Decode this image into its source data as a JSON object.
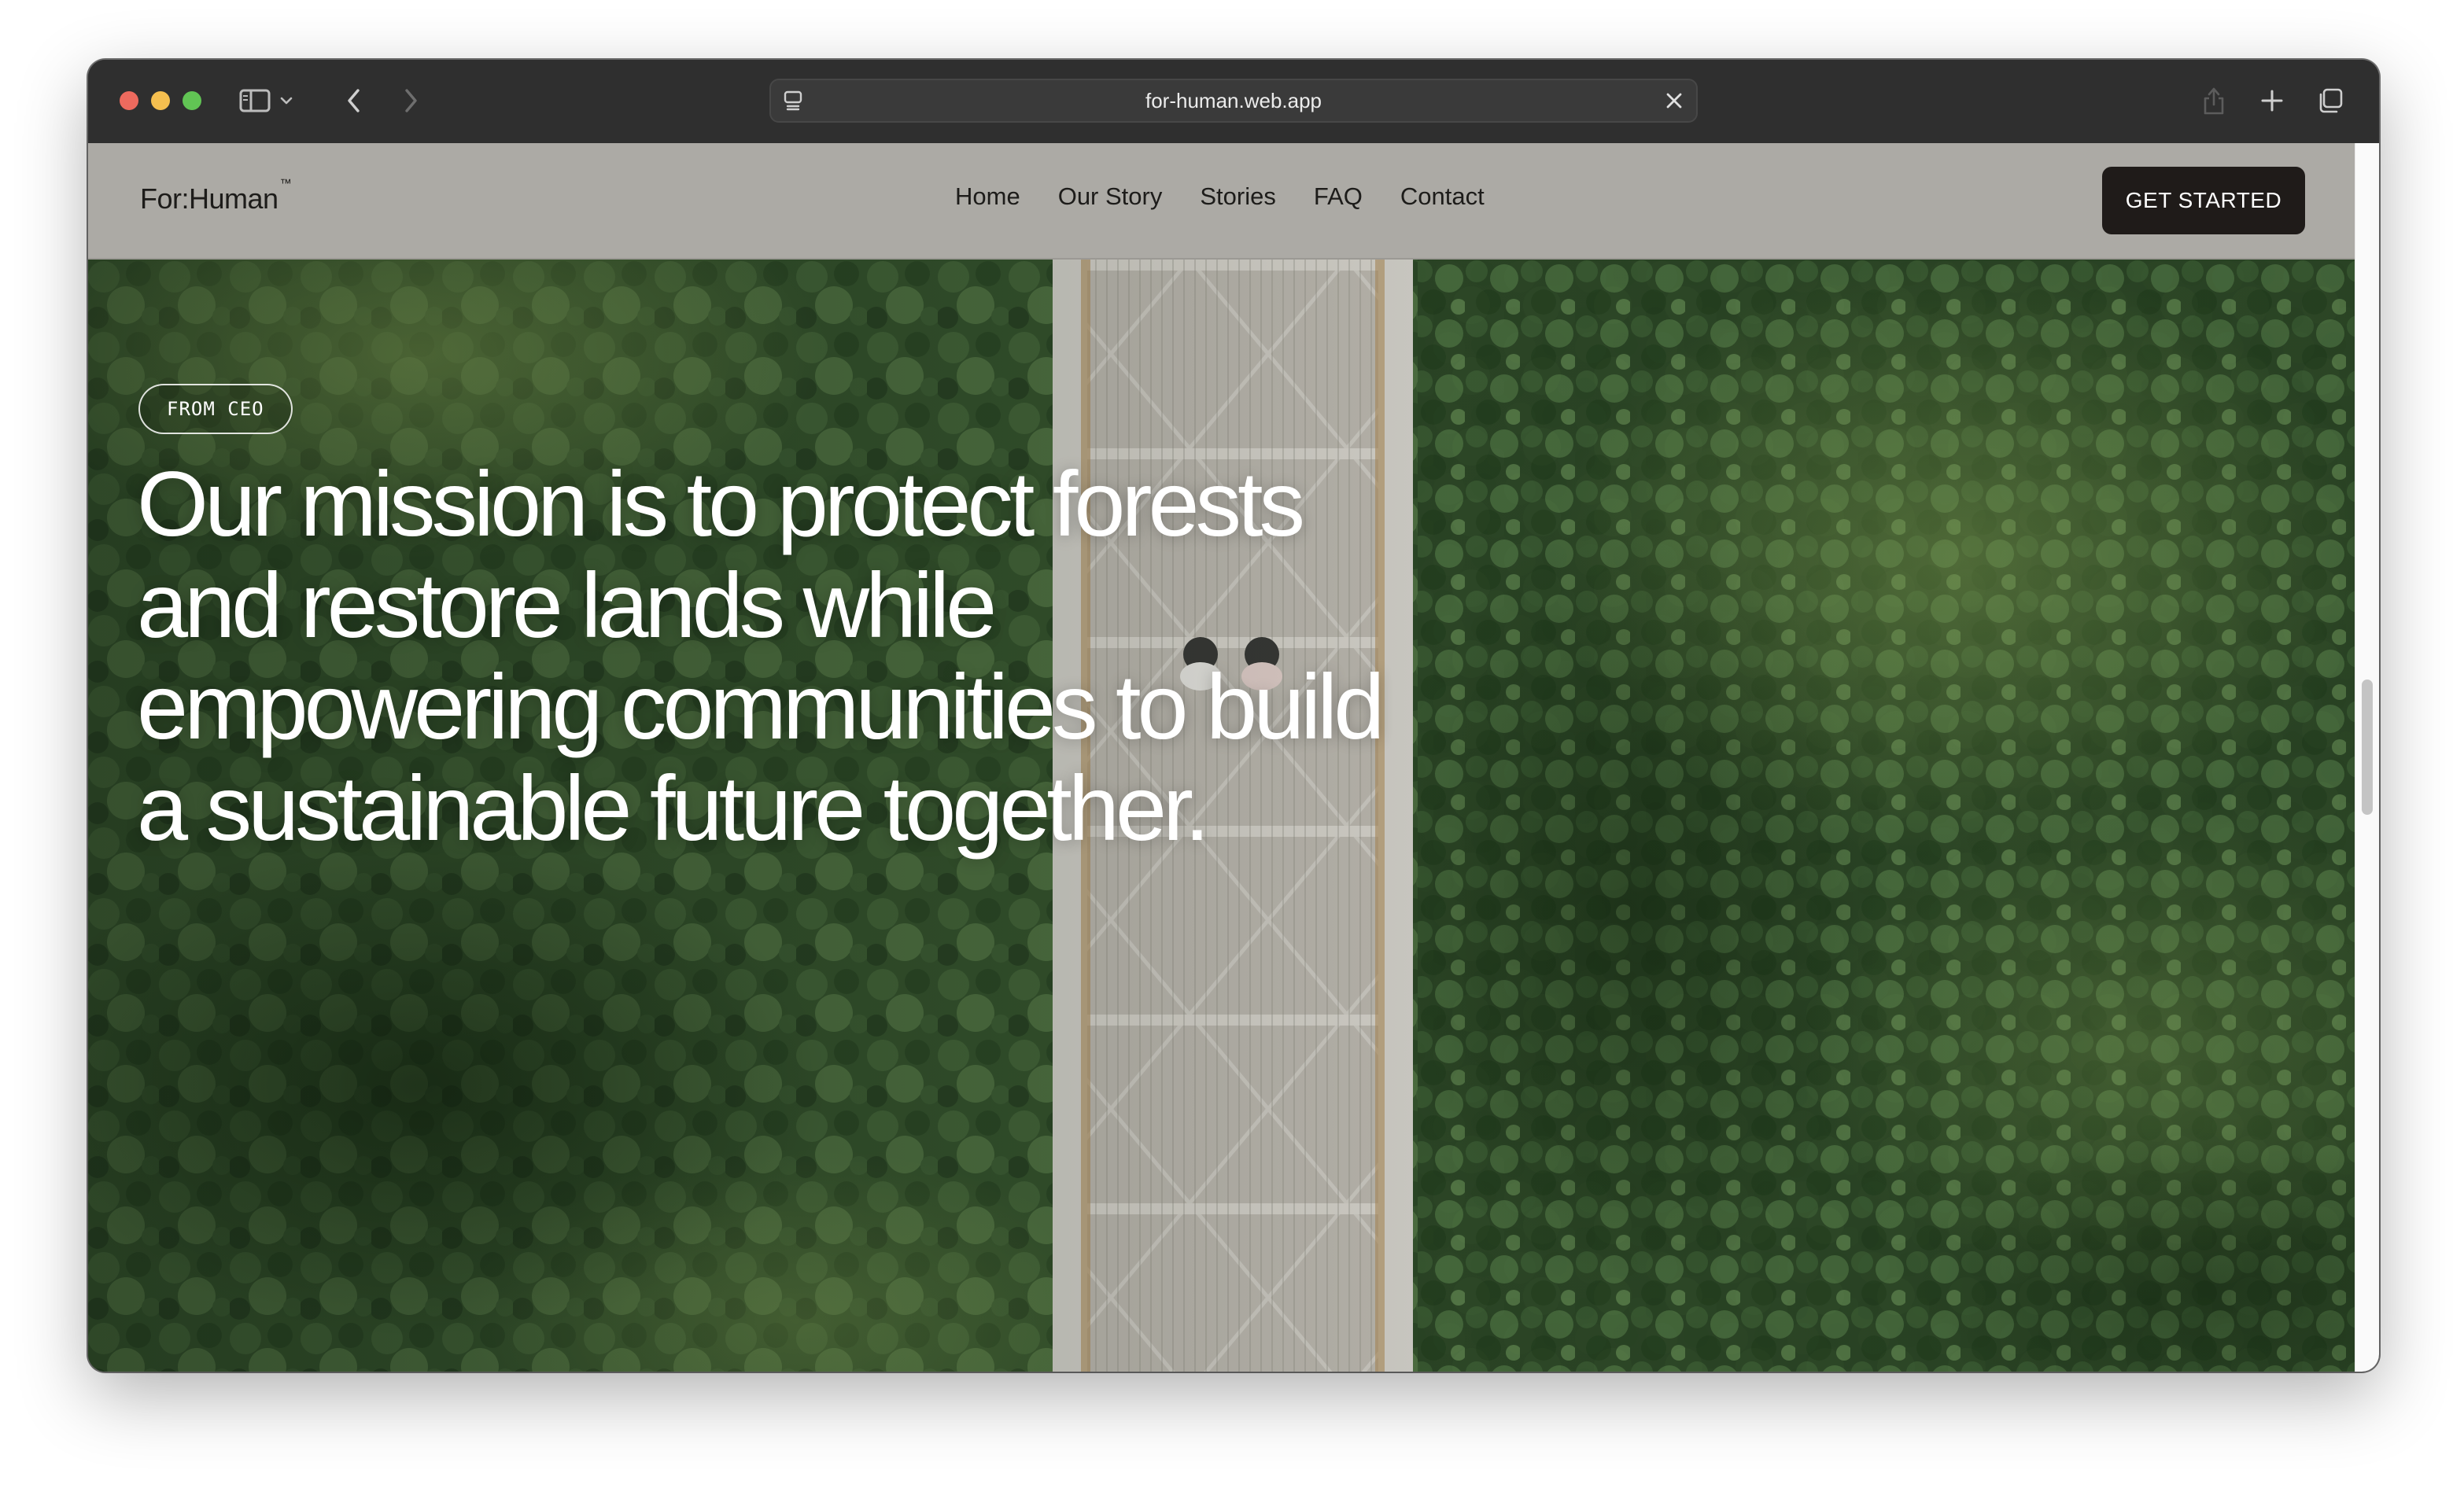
{
  "browser": {
    "url": "for-human.web.app",
    "icons": {
      "sidebar": "sidebar-icon",
      "sidebar_menu": "chevron-down-icon",
      "back": "chevron-left-icon",
      "forward": "chevron-right-icon",
      "page_menu": "page-menu-icon",
      "clear": "close-icon",
      "share": "share-icon",
      "new_tab": "plus-icon",
      "tabs": "tab-overview-icon"
    }
  },
  "site": {
    "logo": "For:Human",
    "logo_mark": "™",
    "nav": [
      "Home",
      "Our Story",
      "Stories",
      "FAQ",
      "Contact"
    ],
    "cta_label": "GET STARTED"
  },
  "hero": {
    "tag": "FROM CEO",
    "headline": "Our mission is to protect forests and restore lands while empowering communities to build a sustainable future together."
  },
  "colors": {
    "header_bg": "#acaaa5",
    "cta_bg": "#1f1b19",
    "chrome_bg": "#2f2f2f",
    "hero_text": "#ffffff"
  }
}
